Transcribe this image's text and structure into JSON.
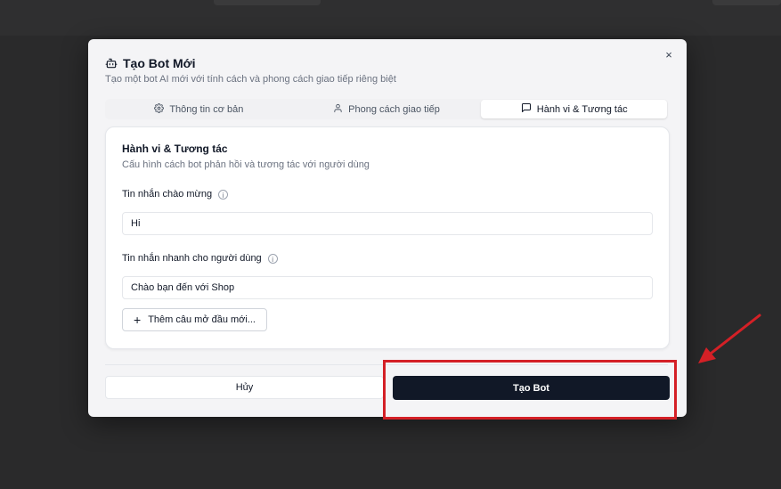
{
  "dialog": {
    "title": "Tạo Bot Mới",
    "subtitle": "Tạo một bot AI mới với tính cách và phong cách giao tiếp riêng biệt",
    "close_symbol": "×"
  },
  "tabs": [
    {
      "label": "Thông tin cơ bản",
      "icon": "gear-icon",
      "active": false
    },
    {
      "label": "Phong cách giao tiếp",
      "icon": "user-icon",
      "active": false
    },
    {
      "label": "Hành vi & Tương tác",
      "icon": "message-square-icon",
      "active": true
    }
  ],
  "section": {
    "title": "Hành vi & Tương tác",
    "description": "Cấu hình cách bot phản hồi và tương tác với người dùng"
  },
  "fields": {
    "greeting": {
      "label": "Tin nhắn chào mừng",
      "value": "Hi"
    },
    "quick_replies": {
      "label": "Tin nhắn nhanh cho người dùng",
      "value": "Chào bạn đến với Shop"
    }
  },
  "add_button": {
    "icon": "+",
    "label": "Thêm câu mở đầu mới..."
  },
  "footer": {
    "cancel_label": "Hủy",
    "create_label": "Tạo Bot"
  },
  "colors": {
    "primary_button": "#111827",
    "annotation_red": "#d42026",
    "backdrop": "#2a2a2b"
  }
}
